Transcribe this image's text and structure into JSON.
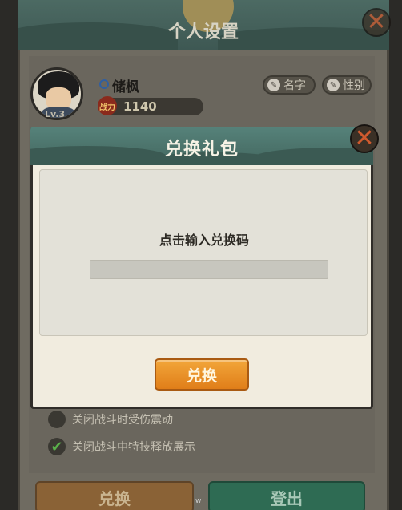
{
  "background_panel": {
    "title": "个人设置",
    "player": {
      "name": "储枫",
      "level": "Lv.3",
      "power_badge": "战力",
      "power": "1140"
    },
    "rename_label": "名字",
    "gender_label": "性别",
    "options": [
      {
        "label": "关闭战斗时受伤震动",
        "checked": false
      },
      {
        "label": "关闭战斗中特技释放展示",
        "checked": true
      }
    ],
    "redeem_label": "兑换",
    "logout_label": "登出",
    "stray_text": "w",
    "close_icon": "close-x-icon"
  },
  "modal": {
    "title": "兑换礼包",
    "prompt": "点击输入兑换码",
    "code_value": "",
    "confirm_label": "兑换",
    "close_icon": "close-x-icon"
  },
  "colors": {
    "accent_orange": "#e88a22",
    "header_teal": "#4d766e",
    "close_red": "#cf5a2e"
  }
}
